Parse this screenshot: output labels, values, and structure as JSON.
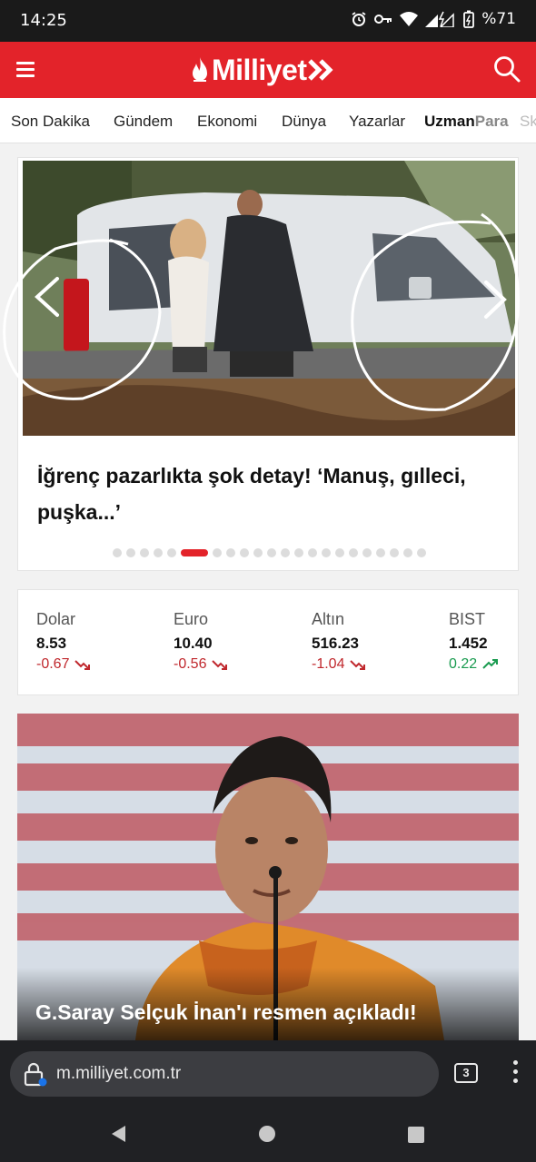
{
  "status_bar": {
    "time": "14:25",
    "battery": "%71",
    "icons": [
      "alarm-icon",
      "key-icon",
      "wifi-icon",
      "signal-icon",
      "battery-icon"
    ]
  },
  "header": {
    "brand": "Milliyet",
    "brand_color": "#e3232a",
    "menu_icon": "hamburger-icon",
    "search_icon": "search-icon"
  },
  "categories": [
    {
      "label": "Son Dakika"
    },
    {
      "label": "Gündem"
    },
    {
      "label": "Ekonomi"
    },
    {
      "label": "Dünya"
    },
    {
      "label": "Yazarlar"
    },
    {
      "label_bold": "Uzman",
      "label_light": "Para"
    },
    {
      "label": "Sk"
    }
  ],
  "hero": {
    "title": "İğrenç pazarlıkta şok detay! ‘Manuş, gılleci, puşka...’",
    "slide_count": 22,
    "active_slide": 6,
    "prev_icon": "chevron-left-icon",
    "next_icon": "chevron-right-icon"
  },
  "market": [
    {
      "name": "Dolar",
      "value": "8.53",
      "change": "-0.67",
      "trend": "down"
    },
    {
      "name": "Euro",
      "value": "10.40",
      "change": "-0.56",
      "trend": "down"
    },
    {
      "name": "Altın",
      "value": "516.23",
      "change": "-1.04",
      "trend": "down"
    },
    {
      "name": "BIST",
      "value": "1.452",
      "change": "0.22",
      "trend": "up"
    }
  ],
  "news": {
    "title": "G.Saray Selçuk İnan'ı resmen açıkladı!"
  },
  "browser": {
    "url": "m.milliyet.com.tr",
    "tab_count": "3"
  }
}
